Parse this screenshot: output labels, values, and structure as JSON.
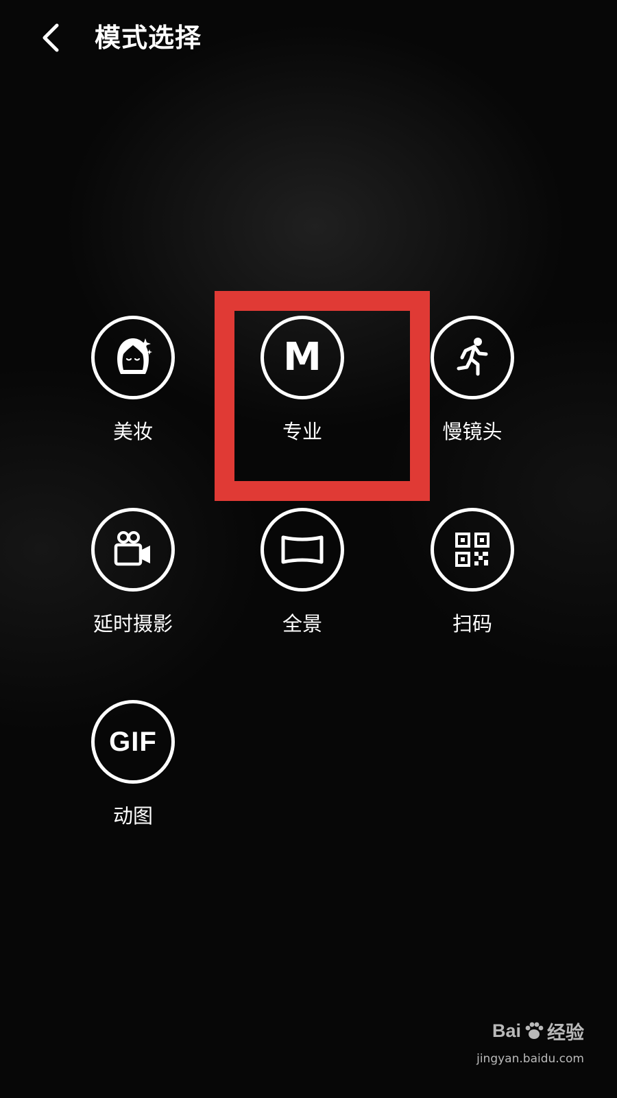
{
  "header": {
    "title": "模式选择",
    "back_icon": "chevron-left-icon"
  },
  "modes": [
    {
      "label": "美妆",
      "icon": "beauty-face-icon"
    },
    {
      "label": "专业",
      "icon": "pro-m-icon",
      "icon_text": "M",
      "highlighted": true
    },
    {
      "label": "慢镜头",
      "icon": "running-person-icon"
    },
    {
      "label": "延时摄影",
      "icon": "video-camera-icon"
    },
    {
      "label": "全景",
      "icon": "panorama-icon"
    },
    {
      "label": "扫码",
      "icon": "qr-code-icon"
    },
    {
      "label": "动图",
      "icon": "gif-icon",
      "icon_text": "GIF"
    }
  ],
  "colors": {
    "background": "#070707",
    "foreground": "#ffffff",
    "highlight": "#e03a35"
  },
  "watermark": {
    "brand_left": "Bai",
    "brand_right": "经验",
    "url": "jingyan.baidu.com"
  }
}
